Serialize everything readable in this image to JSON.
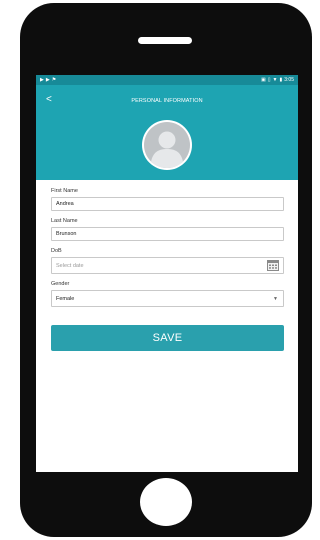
{
  "status_bar": {
    "left_icons": [
      "play-icon",
      "play-icon",
      "flag-icon"
    ],
    "right_icons": [
      "nfc-icon",
      "vibrate-icon",
      "wifi-icon",
      "battery-icon"
    ],
    "time": "3:05"
  },
  "header": {
    "title": "PERSONAL INFORMATION",
    "back_icon": "<"
  },
  "form": {
    "first_name": {
      "label": "First Name",
      "value": "Andrea"
    },
    "last_name": {
      "label": "Last Name",
      "value": "Brunson"
    },
    "dob": {
      "label": "DoB",
      "placeholder": "Select date"
    },
    "gender": {
      "label": "Gender",
      "value": "Female"
    }
  },
  "save_button": {
    "label": "SAVE"
  },
  "colors": {
    "header": "#1ea4b2",
    "status_bar": "#178a98",
    "button": "#2aa0ad",
    "phone_body": "#0d0d0d"
  }
}
